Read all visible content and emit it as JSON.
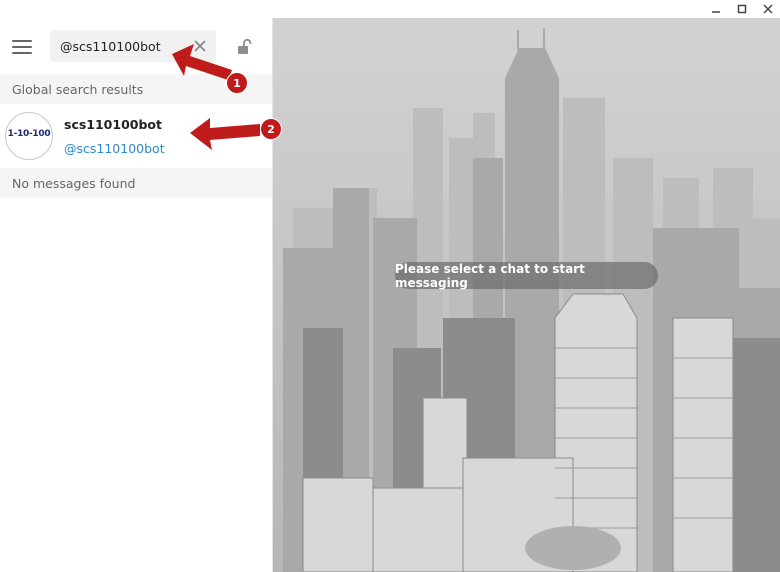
{
  "search": {
    "value": "@scs110100bot"
  },
  "sections": {
    "global_results": "Global search results",
    "no_messages": "No messages found"
  },
  "result": {
    "name": "scs110100bot",
    "handle": "@scs110100bot",
    "avatar_text": "1-10-100"
  },
  "main": {
    "empty_message": "Please select a chat to start messaging"
  },
  "annotations": [
    {
      "number": "1"
    },
    {
      "number": "2"
    }
  ],
  "icons": {
    "menu": "hamburger-icon",
    "clear": "close-icon",
    "lock": "unlock-icon",
    "minimize": "minimize-icon",
    "maximize": "maximize-icon",
    "close": "window-close-icon"
  },
  "colors": {
    "accent": "#2e88c8",
    "annotation": "#c01b1b",
    "search_bg": "#f1f1f1",
    "section_bg": "#f5f5f5"
  }
}
